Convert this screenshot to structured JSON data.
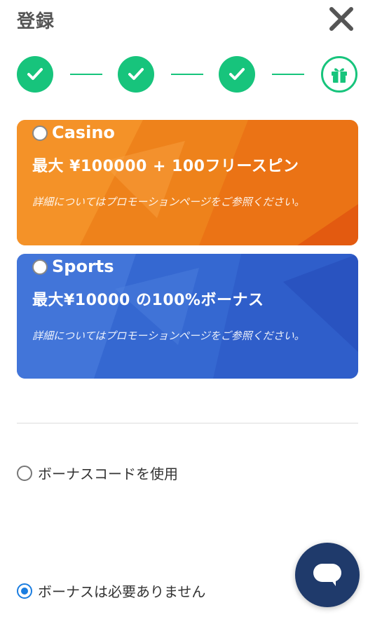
{
  "header": {
    "title": "登録"
  },
  "stepper": {
    "steps": [
      "done",
      "done",
      "done",
      "gift"
    ]
  },
  "cards": [
    {
      "name": "Casino",
      "headline": "最大 ¥100000 + 100フリースピン",
      "note": "詳細についてはプロモーションページをご参照ください。",
      "color": "#f08a1f"
    },
    {
      "name": "Sports",
      "headline": "最大¥10000 の100%ボーナス",
      "note": "詳細についてはプロモーションページをご参照ください。",
      "color": "#3b6fd6"
    }
  ],
  "options": {
    "bonus_code": "ボーナスコードを使用",
    "no_bonus": "ボーナスは必要ありません"
  },
  "colors": {
    "accent_green": "#17c47c",
    "accent_blue": "#1a7de0",
    "chat_bg": "#1f3a6b"
  }
}
